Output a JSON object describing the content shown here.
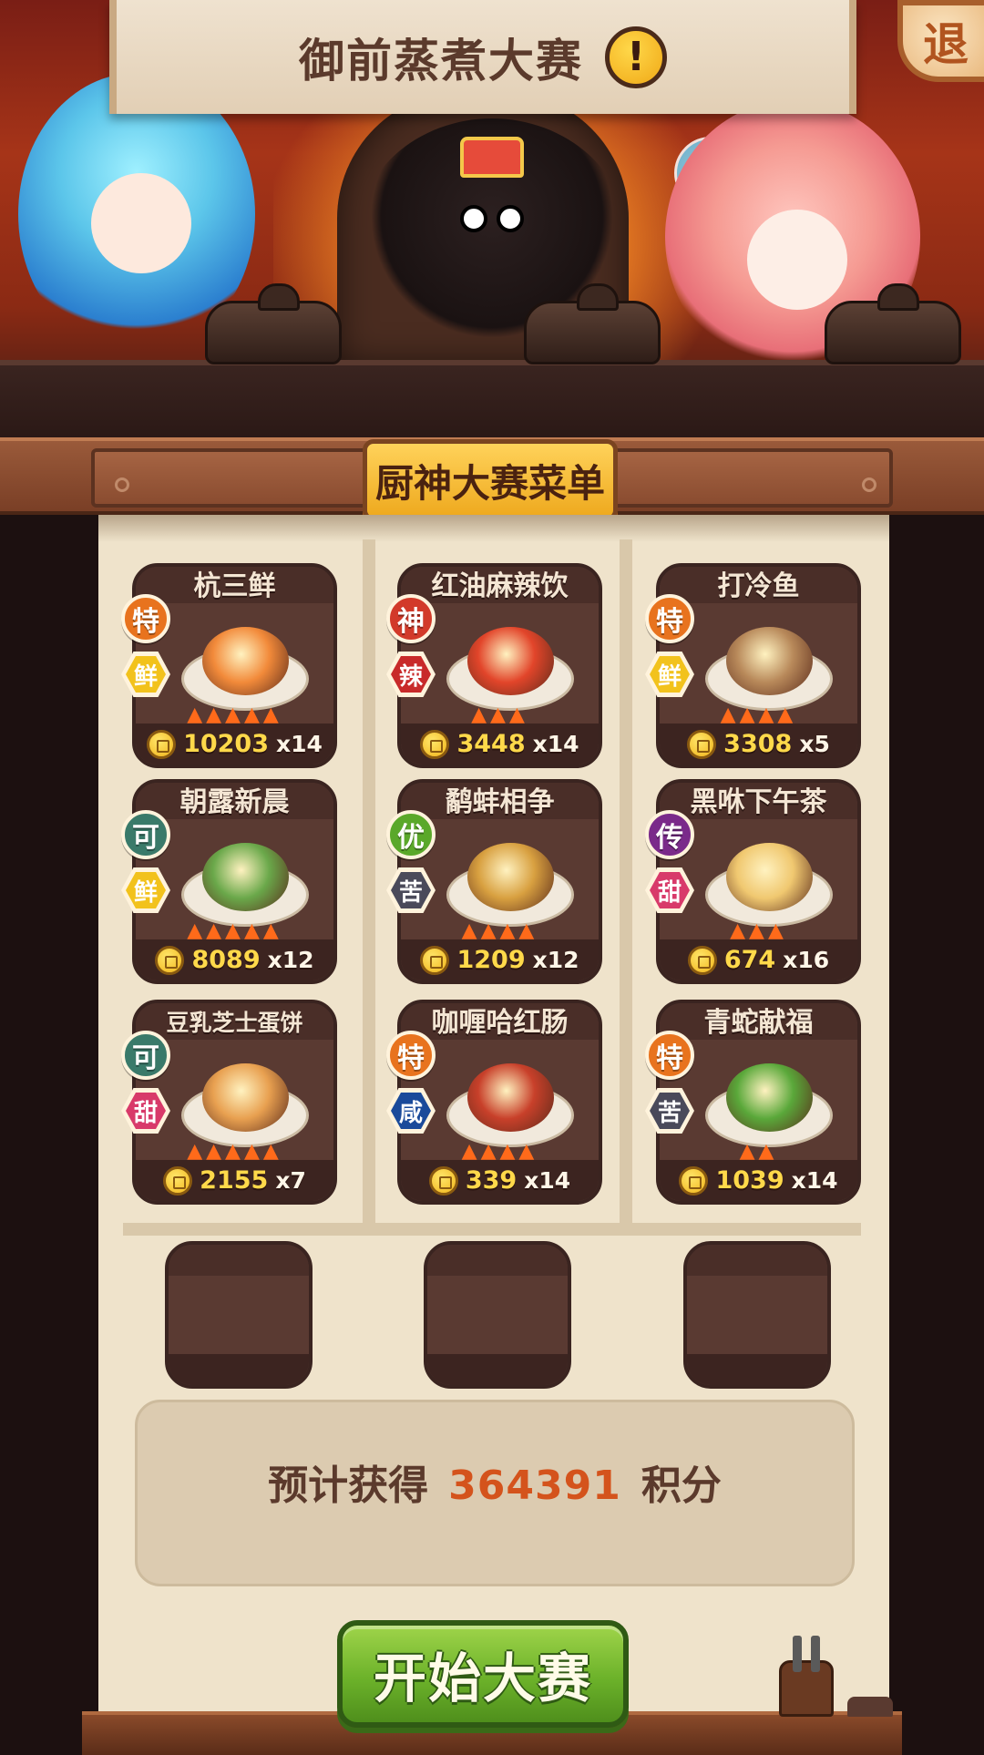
{
  "header": {
    "title": "御前蒸煮大赛",
    "info_icon": "!",
    "exit_label": "退"
  },
  "menu": {
    "title": "厨神大赛菜单"
  },
  "dishes": [
    {
      "name": "杭三鲜",
      "grade": "特",
      "taste": "鲜",
      "flames": 5,
      "price": "10203",
      "qty": "x14",
      "grade_color": "#e8731e",
      "taste_color": "#f2c21c",
      "food_color": "#f28a3a"
    },
    {
      "name": "红油麻辣饮",
      "grade": "神",
      "taste": "辣",
      "flames": 3,
      "price": "3448",
      "qty": "x14",
      "grade_color": "#d23a2a",
      "taste_color": "#c82a2a",
      "food_color": "#e2452a"
    },
    {
      "name": "打冷鱼",
      "grade": "特",
      "taste": "鲜",
      "flames": 4,
      "price": "3308",
      "qty": "x5",
      "grade_color": "#e8731e",
      "taste_color": "#f2c21c",
      "food_color": "#b8895a"
    },
    {
      "name": "朝露新晨",
      "grade": "可",
      "taste": "鲜",
      "flames": 5,
      "price": "8089",
      "qty": "x12",
      "grade_color": "#3a7a6a",
      "taste_color": "#f2c21c",
      "food_color": "#6aa84a"
    },
    {
      "name": "鹬蚌相争",
      "grade": "优",
      "taste": "苦",
      "flames": 4,
      "price": "1209",
      "qty": "x12",
      "grade_color": "#5aa82a",
      "taste_color": "#4a4a5a",
      "food_color": "#d8a040"
    },
    {
      "name": "黑咻下午茶",
      "grade": "传",
      "taste": "甜",
      "flames": 3,
      "price": "674",
      "qty": "x16",
      "grade_color": "#7a2a8a",
      "taste_color": "#d83a6a",
      "food_color": "#f0c870"
    },
    {
      "name": "豆乳芝士蛋饼",
      "grade": "可",
      "taste": "甜",
      "flames": 5,
      "price": "2155",
      "qty": "x7",
      "grade_color": "#3a7a6a",
      "taste_color": "#d83a6a",
      "food_color": "#e8a050"
    },
    {
      "name": "咖喱哈红肠",
      "grade": "特",
      "taste": "咸",
      "flames": 4,
      "price": "339",
      "qty": "x14",
      "grade_color": "#e8731e",
      "taste_color": "#1a4a9a",
      "food_color": "#c8402a"
    },
    {
      "name": "青蛇献福",
      "grade": "特",
      "taste": "苦",
      "flames": 2,
      "price": "1039",
      "qty": "x14",
      "grade_color": "#e8731e",
      "taste_color": "#4a4a5a",
      "food_color": "#5aa83a"
    }
  ],
  "empty_slots": 3,
  "score": {
    "prefix": "预计获得",
    "value": "364391",
    "suffix": "积分"
  },
  "start_button": {
    "label": "开始大赛"
  },
  "colors": {
    "panel": "#efe3cb",
    "card": "#5a3a32",
    "coin": "#ffd94a",
    "score_value": "#d4531c",
    "start_button": "#6cb22a"
  }
}
